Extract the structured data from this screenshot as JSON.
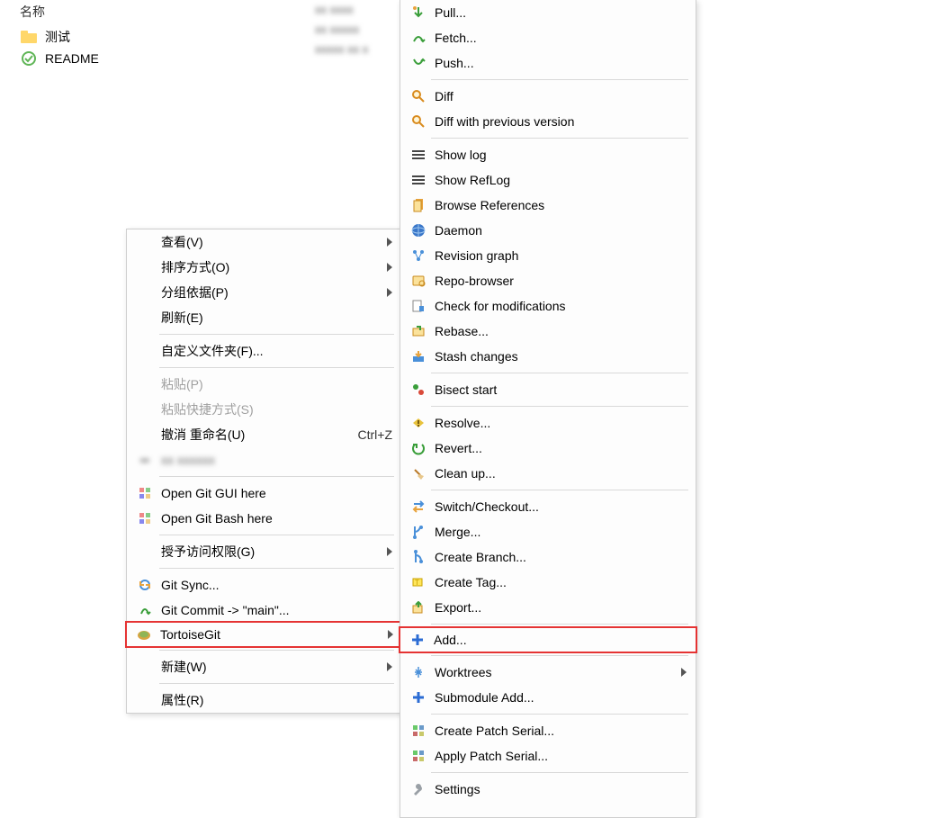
{
  "fileArea": {
    "header": "名称",
    "rows": [
      {
        "name": "测试"
      },
      {
        "name": "README"
      }
    ],
    "blurCol": [
      "xx xxxx",
      "xx xxxxx",
      "xxxxx xx x"
    ]
  },
  "menu1": {
    "view": "查看(V)",
    "sort": "排序方式(O)",
    "group": "分组依据(P)",
    "refresh": "刷新(E)",
    "customize": "自定义文件夹(F)...",
    "paste": "粘贴(P)",
    "pasteShortcut": "粘贴快捷方式(S)",
    "undo": "撤消 重命名(U)",
    "undoKey": "Ctrl+Z",
    "blurred": "xx xxxxxx",
    "gitGui": "Open Git GUI here",
    "gitBash": "Open Git Bash here",
    "grantAccess": "授予访问权限(G)",
    "gitSync": "Git Sync...",
    "gitCommit": "Git Commit -> \"main\"...",
    "tortoiseGit": "TortoiseGit",
    "new": "新建(W)",
    "properties": "属性(R)"
  },
  "menu2": {
    "pull": "Pull...",
    "fetch": "Fetch...",
    "push": "Push...",
    "diff": "Diff",
    "diffPrev": "Diff with previous version",
    "showLog": "Show log",
    "showRefLog": "Show RefLog",
    "browseRefs": "Browse References",
    "daemon": "Daemon",
    "revisionGraph": "Revision graph",
    "repoBrowser": "Repo-browser",
    "checkMods": "Check for modifications",
    "rebase": "Rebase...",
    "stash": "Stash changes",
    "bisect": "Bisect start",
    "resolve": "Resolve...",
    "revert": "Revert...",
    "cleanup": "Clean up...",
    "switch": "Switch/Checkout...",
    "merge": "Merge...",
    "createBranch": "Create Branch...",
    "createTag": "Create Tag...",
    "export": "Export...",
    "add": "Add...",
    "worktrees": "Worktrees",
    "submoduleAdd": "Submodule Add...",
    "createPatch": "Create Patch Serial...",
    "applyPatch": "Apply Patch Serial...",
    "settings": "Settings"
  }
}
